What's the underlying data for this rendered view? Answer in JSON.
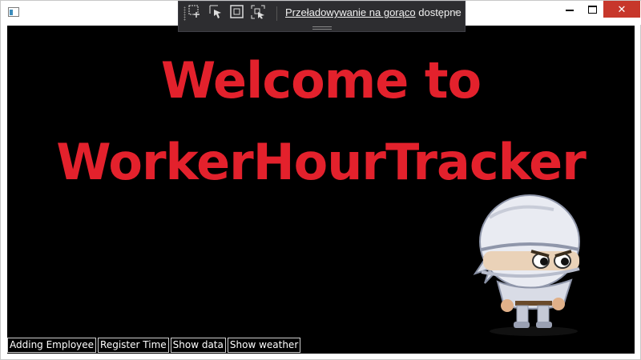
{
  "window": {
    "controls": {
      "minimize": "—",
      "maximize": "☐",
      "close": "✕"
    }
  },
  "hot_reload_toolbar": {
    "link_text": "Przeładowywanie na gorąco",
    "status_text": "dostępne",
    "icons": [
      "select-element-icon",
      "select-pointer-icon",
      "frame-icon",
      "track-focus-icon"
    ],
    "chevron": "‹"
  },
  "main": {
    "heading_line1": "Welcome to",
    "heading_line2": "WorkerHourTracker",
    "heading_color": "#e3212c",
    "background_color": "#000000",
    "image": "ninja-character-icon"
  },
  "buttons": [
    {
      "label": "Adding Employee"
    },
    {
      "label": "Register Time"
    },
    {
      "label": "Show data"
    },
    {
      "label": "Show weather"
    }
  ]
}
